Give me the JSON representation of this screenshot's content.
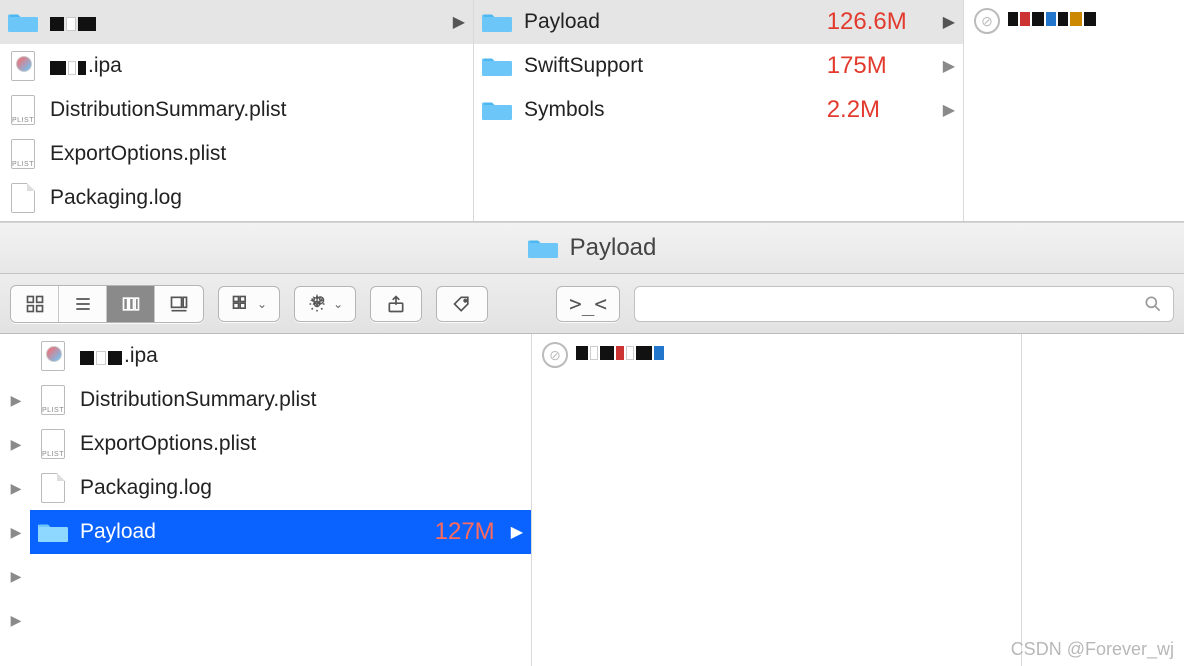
{
  "top": {
    "col1": [
      {
        "icon": "folder",
        "name_censored": true,
        "name": "",
        "chevron": true,
        "selected": true
      },
      {
        "icon": "ipa",
        "name_censored_prefix": true,
        "name": ".ipa"
      },
      {
        "icon": "plist",
        "name": "DistributionSummary.plist"
      },
      {
        "icon": "plist",
        "name": "ExportOptions.plist"
      },
      {
        "icon": "file",
        "name": "Packaging.log"
      }
    ],
    "col2": [
      {
        "icon": "folder",
        "name": "Payload",
        "size": "126.6M",
        "chevron": true,
        "selected": true
      },
      {
        "icon": "folder",
        "name": "SwiftSupport",
        "size": "175M",
        "chevron": true
      },
      {
        "icon": "folder",
        "name": "Symbols",
        "size": "2.2M",
        "chevron": true
      }
    ],
    "col3_preview_censored": true
  },
  "titlebar": {
    "title": "Payload"
  },
  "toolbar": {
    "views": [
      "icons",
      "list",
      "columns",
      "gallery"
    ],
    "active_view": "columns"
  },
  "bottom": {
    "disclosures": [
      "none",
      "chev",
      "chev",
      "chev",
      "chev",
      "chev",
      "chev"
    ],
    "col1": [
      {
        "icon": "ipa",
        "name_censored_prefix": true,
        "name": ".ipa"
      },
      {
        "icon": "plist",
        "name": "DistributionSummary.plist"
      },
      {
        "icon": "plist",
        "name": "ExportOptions.plist"
      },
      {
        "icon": "file",
        "name": "Packaging.log"
      },
      {
        "icon": "folder",
        "name": "Payload",
        "size": "127M",
        "chevron": true,
        "selected": true
      }
    ],
    "col2_preview_censored": true
  },
  "watermark": "CSDN @Forever_wj"
}
